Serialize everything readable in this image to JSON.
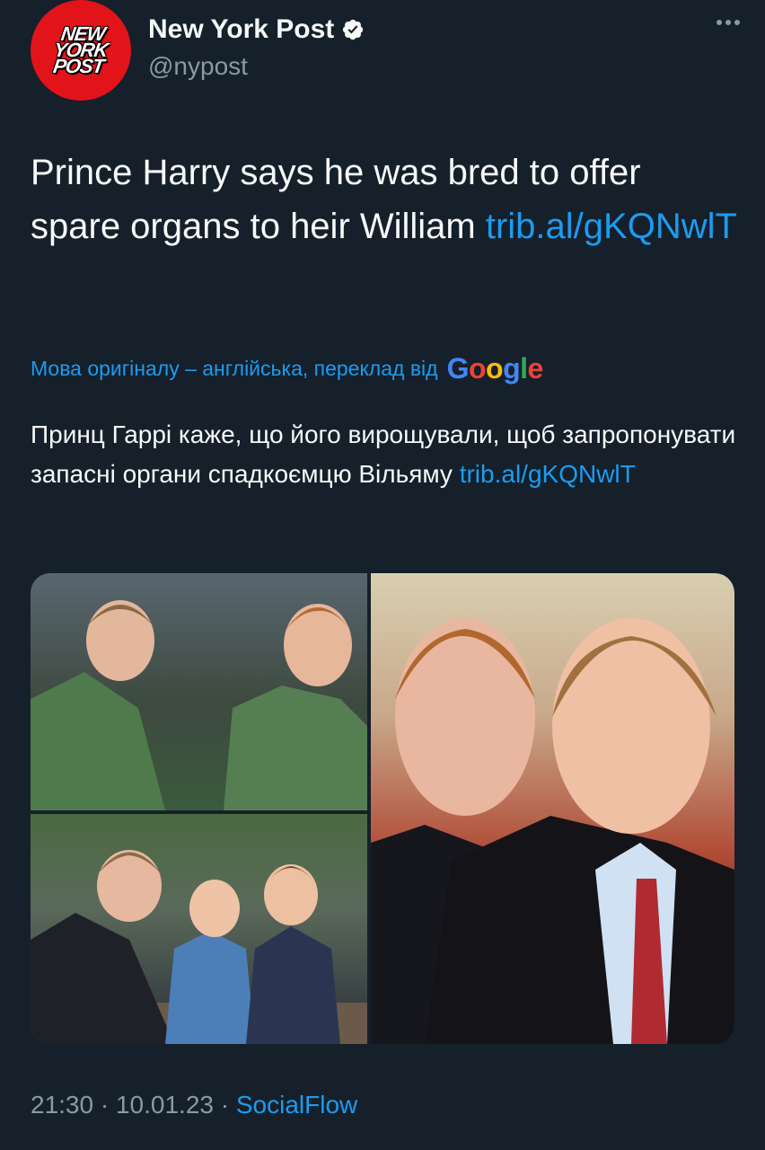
{
  "account": {
    "name": "New York Post",
    "handle": "@nypost",
    "avatar_text": [
      "NEW",
      "YORK",
      "POST"
    ],
    "verified": true
  },
  "tweet": {
    "text": "Prince Harry says he was bred to offer spare organs to heir William ",
    "link": "trib.al/gKQNwlT"
  },
  "translation": {
    "notice": "Мова оригіналу – англійська, переклад від",
    "provider_letters": [
      "G",
      "o",
      "o",
      "g",
      "l",
      "e"
    ],
    "text": "Принц Гаррі каже, що його вирощували, щоб запропонувати запасні органи спадкоємцю Вільяму ",
    "link": "trib.al/gKQNwlT"
  },
  "footer": {
    "time": "21:30",
    "separator": " · ",
    "date": "10.01.23",
    "source": "SocialFlow"
  },
  "colors": {
    "background": "#15202b",
    "text": "#f7f9f9",
    "secondary": "#8b98a5",
    "link": "#1d9bf0",
    "avatar": "#e3131a"
  },
  "icons": [
    "verified-badge-icon",
    "more-options-icon"
  ]
}
